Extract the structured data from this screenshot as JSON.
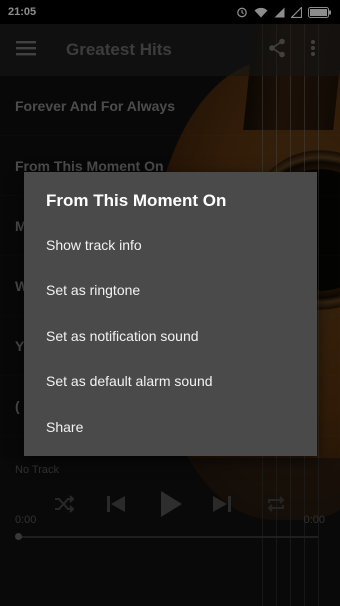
{
  "status_bar": {
    "time": "21:05"
  },
  "toolbar": {
    "title": "Greatest Hits"
  },
  "tracks": [
    "Forever And For Always",
    "From This Moment On",
    "M",
    "W",
    "Y",
    "("
  ],
  "dialog": {
    "title": "From This Moment On",
    "options": [
      "Show track info",
      "Set as ringtone",
      "Set as notification sound",
      "Set as default alarm sound",
      "Share"
    ]
  },
  "player": {
    "now_playing": "No Track",
    "elapsed": "0:00",
    "duration": "0:00"
  },
  "colors": {
    "dialog_bg": "#4a4a4a",
    "toolbar_title": "#6d6d6d",
    "status_bar_bg": "#000000"
  }
}
